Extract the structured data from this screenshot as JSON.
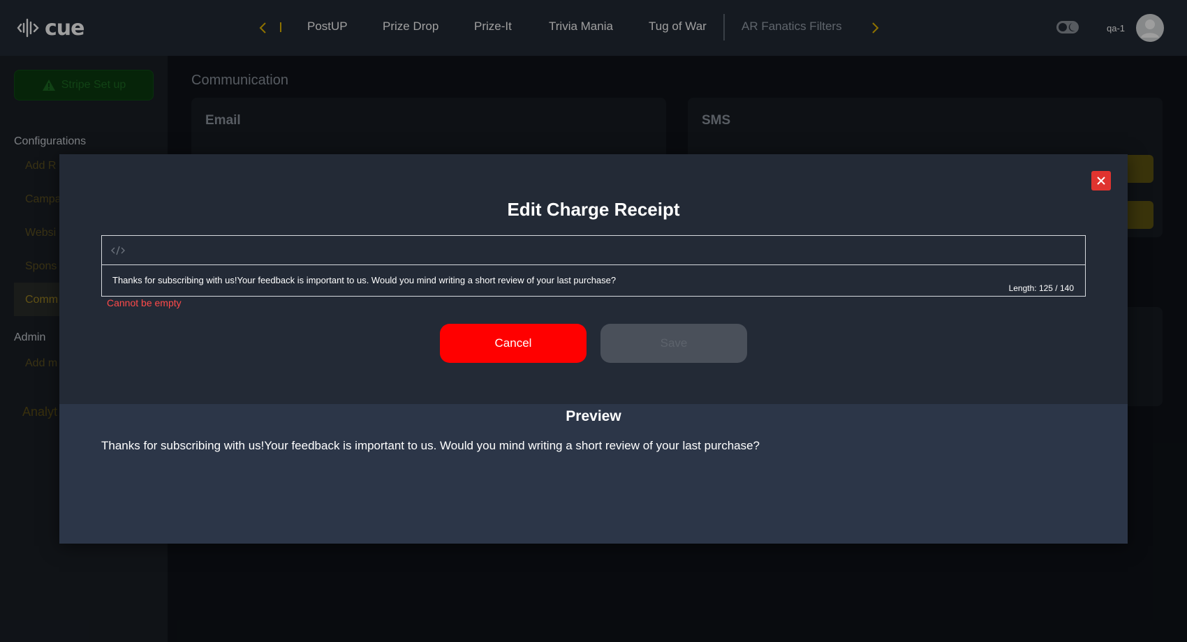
{
  "header": {
    "logo_text": "cue",
    "tabs": [
      {
        "label": "PostUP"
      },
      {
        "label": "Prize Drop"
      },
      {
        "label": "Prize-It"
      },
      {
        "label": "Trivia Mania"
      },
      {
        "label": "Tug of War"
      },
      {
        "label": "AR Fanatics Filters"
      }
    ],
    "user_name": "qa-1",
    "accent_color": "#e6b800"
  },
  "sidebar": {
    "stripe_button": "Stripe Set up",
    "configurations_heading": "Configurations",
    "config_items": [
      {
        "label": "Add R"
      },
      {
        "label": "Campa"
      },
      {
        "label": "Websi"
      },
      {
        "label": "Spons"
      },
      {
        "label": "Comm"
      }
    ],
    "admin_heading": "Admin",
    "admin_items": [
      {
        "label": "Add m"
      }
    ],
    "analytics_label": "Analyt"
  },
  "main": {
    "title": "Communication",
    "cards": [
      {
        "title": "Email"
      },
      {
        "title": "SMS"
      }
    ]
  },
  "modal": {
    "title": "Edit Charge Receipt",
    "editor_text": "Thanks for subscribing with us!Your feedback is important to us. Would you mind writing a short review of your last purchase?",
    "length_text": "Length: 125 / 140",
    "error_text": "Cannot be empty",
    "cancel_label": "Cancel",
    "save_label": "Save",
    "preview_title": "Preview",
    "preview_text": "Thanks for subscribing with us!Your feedback is important to us. Would you mind writing a short review of your last purchase?"
  },
  "colors": {
    "cancel_button": "#ff0000",
    "close_button": "#e0342f",
    "error_text": "#ff4a4a",
    "modal_bg": "#232a36",
    "preview_bg": "#2c3648"
  }
}
